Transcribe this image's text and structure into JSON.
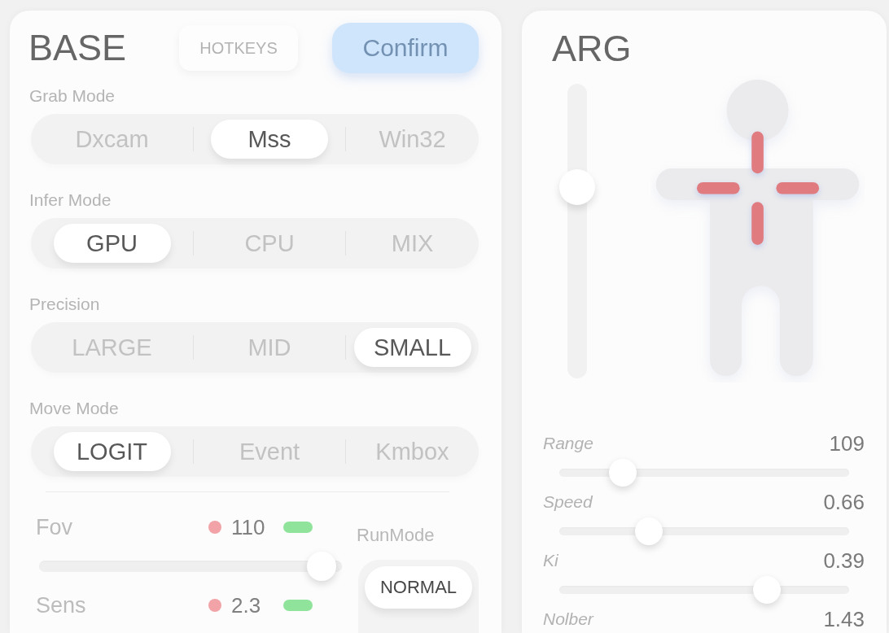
{
  "base_panel": {
    "title": "BASE",
    "hotkeys_button": "HOTKEYS",
    "confirm_button": "Confirm",
    "mode_groups": [
      {
        "label": "Grab Mode",
        "options": [
          {
            "label": "Dxcam",
            "selected": false
          },
          {
            "label": "Mss",
            "selected": true
          },
          {
            "label": "Win32",
            "selected": false
          }
        ]
      },
      {
        "label": "Infer Mode",
        "options": [
          {
            "label": "GPU",
            "selected": true
          },
          {
            "label": "CPU",
            "selected": false
          },
          {
            "label": "MIX",
            "selected": false
          }
        ]
      },
      {
        "label": "Precision",
        "options": [
          {
            "label": "LARGE",
            "selected": false
          },
          {
            "label": "MID",
            "selected": false
          },
          {
            "label": "SMALL",
            "selected": true
          }
        ]
      },
      {
        "label": "Move Mode",
        "options": [
          {
            "label": "LOGIT",
            "selected": true
          },
          {
            "label": "Event",
            "selected": false
          },
          {
            "label": "Kmbox",
            "selected": false
          }
        ]
      }
    ],
    "adjusters": [
      {
        "label": "Fov",
        "value": "110",
        "level": 0.98
      },
      {
        "label": "Sens",
        "value": "2.3"
      }
    ],
    "run_mode": {
      "label": "RunMode",
      "options": [
        {
          "label": "NORMAL",
          "selected": true
        }
      ]
    }
  },
  "arg_panel": {
    "title": "ARG",
    "aim_slider": {
      "level": 0.67
    },
    "sliders": [
      {
        "label": "Range",
        "value": "109",
        "level": 0.19
      },
      {
        "label": "Speed",
        "value": "0.66",
        "level": 0.29
      },
      {
        "label": "Ki",
        "value": "0.39",
        "level": 0.74
      },
      {
        "label": "Nolber",
        "value": "1.43"
      }
    ]
  }
}
